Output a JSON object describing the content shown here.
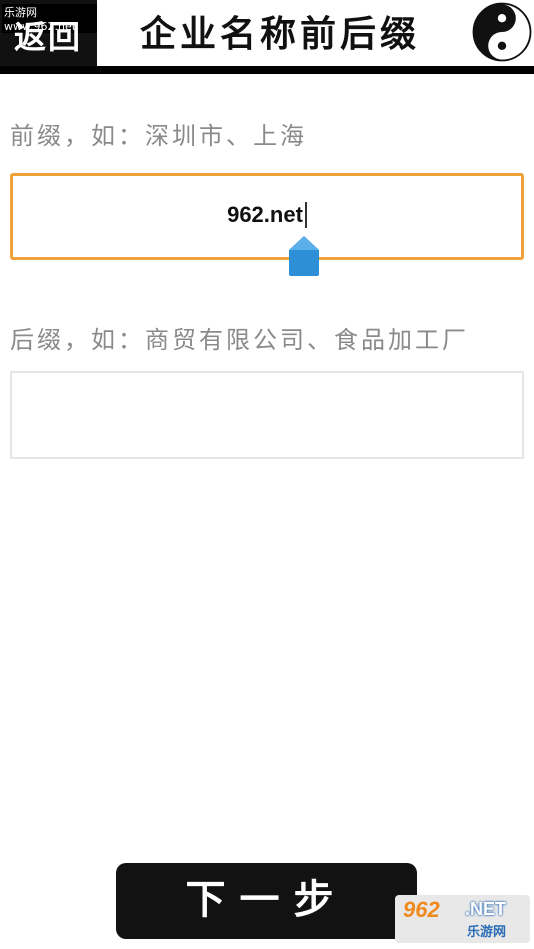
{
  "header": {
    "watermark": "乐游网 www.962.net",
    "back_label": "返回",
    "title": "企业名称前后缀",
    "logo_icon": "yin-yang-icon"
  },
  "prefix": {
    "label": "前缀，如：深圳市、上海",
    "value": "962.net"
  },
  "suffix": {
    "label": "后缀，如：商贸有限公司、食品加工厂",
    "value": ""
  },
  "footer": {
    "next_label": "下一步"
  },
  "watermark_logo": {
    "number": "962",
    "domain": ".NET",
    "name": "乐游网"
  },
  "colors": {
    "focus_border": "#f0a23a",
    "handle": "#2d8fd6",
    "header_bg": "#111111"
  }
}
